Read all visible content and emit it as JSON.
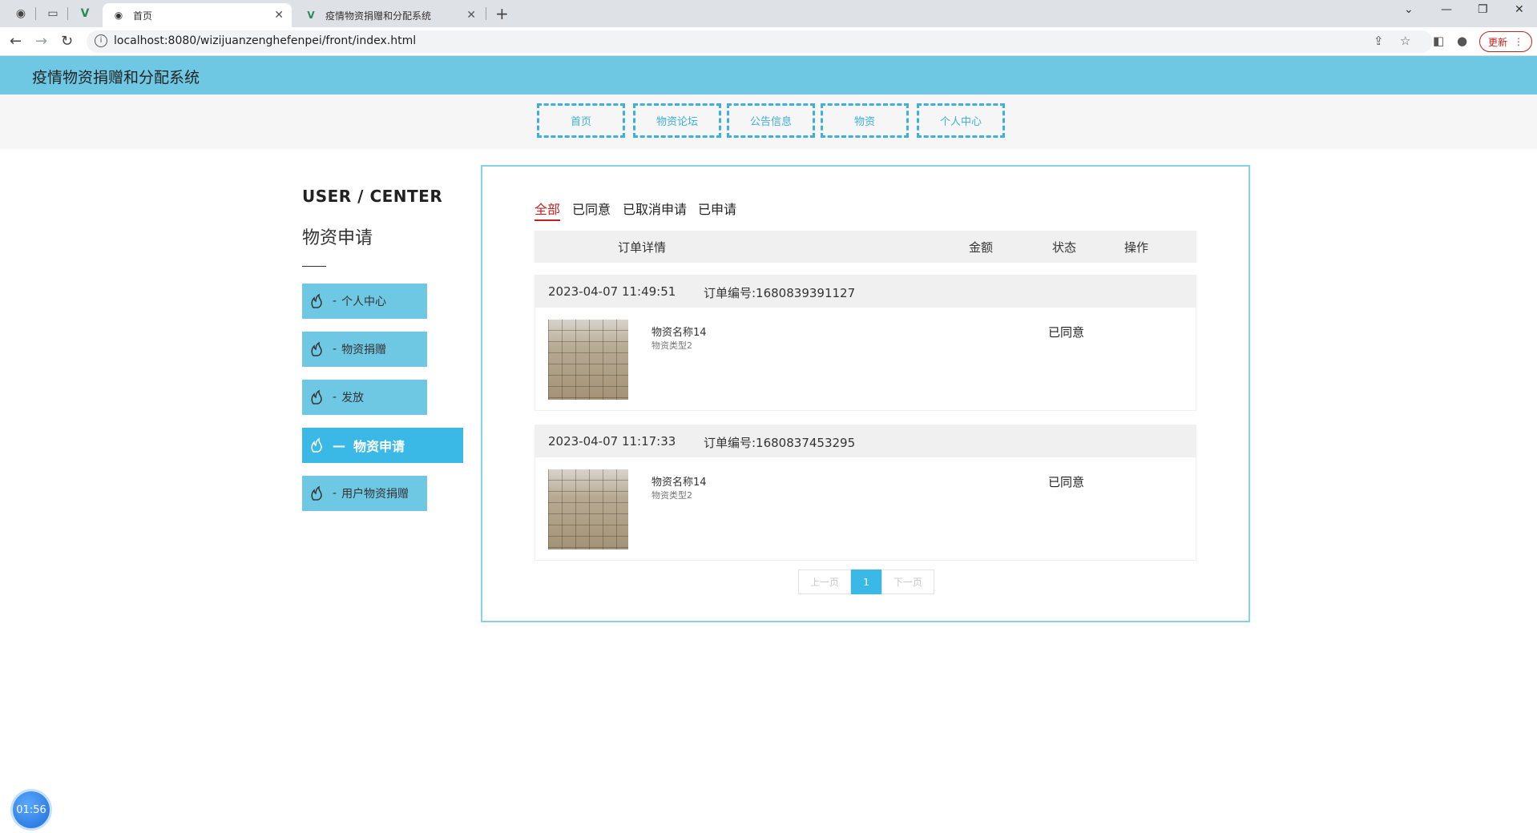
{
  "browser": {
    "tabs": [
      {
        "label": "首页",
        "active": true
      },
      {
        "label": "疫情物资捐赠和分配系统",
        "active": false
      }
    ],
    "url": "localhost:8080/wizijuanzenghefenpei/front/index.html",
    "update_label": "更新"
  },
  "site": {
    "title": "疫情物资捐赠和分配系统",
    "nav": [
      "首页",
      "物资论坛",
      "公告信息",
      "物资",
      "个人中心"
    ]
  },
  "sidebar": {
    "title": "USER / CENTER",
    "subtitle": "物资申请",
    "items": [
      {
        "label": "个人中心",
        "active": false
      },
      {
        "label": "物资捐赠",
        "active": false
      },
      {
        "label": "发放",
        "active": false
      },
      {
        "label": "物资申请",
        "active": true
      },
      {
        "label": "用户物资捐赠",
        "active": false
      }
    ]
  },
  "orders": {
    "tabs": [
      "全部",
      "已同意",
      "已取消申请",
      "已申请"
    ],
    "active_tab": "全部",
    "columns": [
      "订单详情",
      "金额",
      "状态",
      "操作"
    ],
    "list": [
      {
        "time": "2023-04-07 11:49:51",
        "order_no": "订单编号:1680839391127",
        "name": "物资名称14",
        "type": "物资类型2",
        "status": "已同意"
      },
      {
        "time": "2023-04-07 11:17:33",
        "order_no": "订单编号:1680837453295",
        "name": "物资名称14",
        "type": "物资类型2",
        "status": "已同意"
      }
    ],
    "pager": {
      "prev": "上一页",
      "current": "1",
      "next": "下一页"
    }
  },
  "timer": "01:56",
  "colors": {
    "header": "#6ec8e4",
    "accent": "#3ab9e6",
    "active_tab": "#c5221f"
  }
}
